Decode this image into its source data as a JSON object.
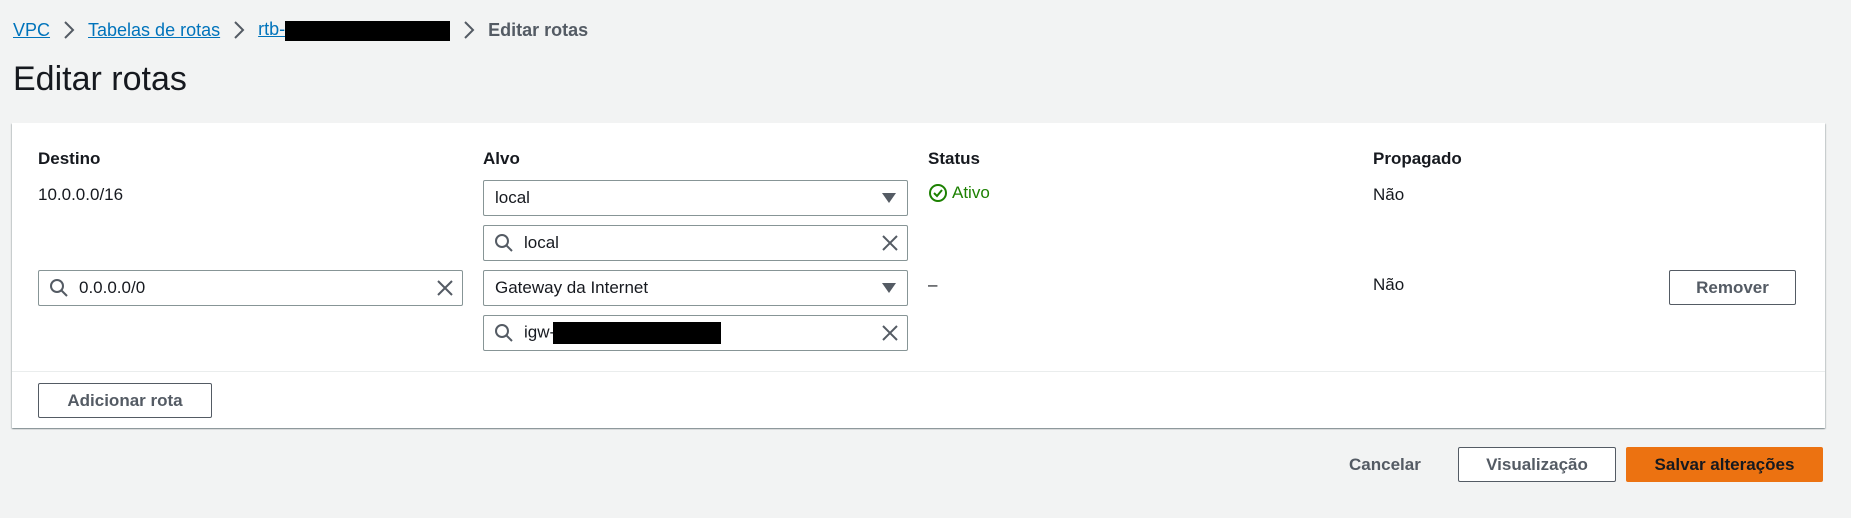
{
  "breadcrumb": {
    "vpc": "VPC",
    "route_tables": "Tabelas de rotas",
    "rtb_prefix": "rtb-",
    "current": "Editar rotas"
  },
  "page": {
    "title": "Editar rotas"
  },
  "table": {
    "headers": {
      "destination": "Destino",
      "target": "Alvo",
      "status": "Status",
      "propagated": "Propagado"
    },
    "rows": [
      {
        "destination": "10.0.0.0/16",
        "target_type": "local",
        "target_search": "local",
        "status": "Ativo",
        "propagated": "Não"
      },
      {
        "destination": "0.0.0.0/0",
        "target_type": "Gateway da Internet",
        "target_search_prefix": "igw-",
        "status": "–",
        "propagated": "Não",
        "remove_label": "Remover"
      }
    ]
  },
  "actions": {
    "add_route": "Adicionar rota",
    "cancel": "Cancelar",
    "preview": "Visualização",
    "save": "Salvar alterações"
  },
  "colors": {
    "link": "#0073bb",
    "success": "#1d8102",
    "primary": "#ec7211",
    "background": "#f2f3f3"
  }
}
